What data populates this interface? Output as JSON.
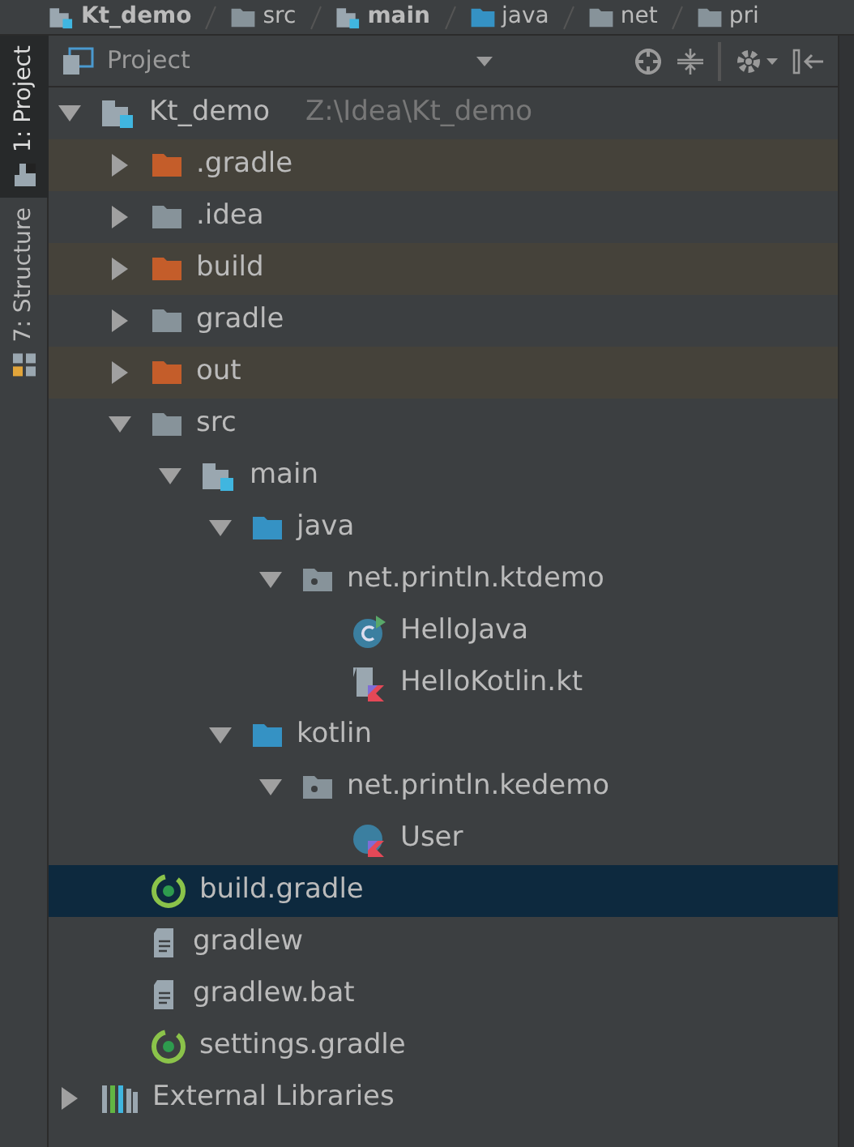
{
  "breadcrumb": [
    {
      "label": "Kt_demo",
      "kind": "module"
    },
    {
      "label": "src",
      "kind": "folder"
    },
    {
      "label": "main",
      "kind": "module"
    },
    {
      "label": "java",
      "kind": "folder-source"
    },
    {
      "label": "net",
      "kind": "folder"
    },
    {
      "label": "pri",
      "kind": "folder"
    }
  ],
  "tool_stripe": [
    {
      "label": "1: Project",
      "selected": true,
      "kind": "project"
    },
    {
      "label": "7: Structure",
      "selected": false,
      "kind": "structure"
    }
  ],
  "panel": {
    "title": "Project"
  },
  "tree": [
    {
      "label": "Kt_demo",
      "hint": "Z:\\Idea\\Kt_demo",
      "kind": "module",
      "expanded": true,
      "selected": false,
      "children": [
        {
          "label": ".gradle",
          "kind": "folder-excluded",
          "expanded": false,
          "selected": false
        },
        {
          "label": ".idea",
          "kind": "folder",
          "expanded": false,
          "selected": false
        },
        {
          "label": "build",
          "kind": "folder-excluded",
          "expanded": false,
          "selected": false
        },
        {
          "label": "gradle",
          "kind": "folder",
          "expanded": false,
          "selected": false
        },
        {
          "label": "out",
          "kind": "folder-excluded",
          "expanded": false,
          "selected": false
        },
        {
          "label": "src",
          "kind": "folder",
          "expanded": true,
          "selected": false,
          "children": [
            {
              "label": "main",
              "kind": "module",
              "expanded": true,
              "selected": false,
              "children": [
                {
                  "label": "java",
                  "kind": "folder-source",
                  "expanded": true,
                  "selected": false,
                  "children": [
                    {
                      "label": "net.println.ktdemo",
                      "kind": "package",
                      "expanded": true,
                      "selected": false,
                      "children": [
                        {
                          "label": "HelloJava",
                          "kind": "class-java",
                          "selected": false
                        },
                        {
                          "label": "HelloKotlin.kt",
                          "kind": "kotlin-file",
                          "selected": false
                        }
                      ]
                    }
                  ]
                },
                {
                  "label": "kotlin",
                  "kind": "folder-source",
                  "expanded": true,
                  "selected": false,
                  "children": [
                    {
                      "label": "net.println.kedemo",
                      "kind": "package",
                      "expanded": true,
                      "selected": false,
                      "children": [
                        {
                          "label": "User",
                          "kind": "kotlin-class",
                          "selected": false
                        }
                      ]
                    }
                  ]
                }
              ]
            }
          ]
        },
        {
          "label": "build.gradle",
          "kind": "gradle",
          "selected": true
        },
        {
          "label": "gradlew",
          "kind": "text-file",
          "selected": false
        },
        {
          "label": "gradlew.bat",
          "kind": "text-file",
          "selected": false
        },
        {
          "label": "settings.gradle",
          "kind": "gradle",
          "selected": false
        }
      ]
    },
    {
      "label": "External Libraries",
      "kind": "libraries",
      "expanded": false,
      "selected": false
    }
  ]
}
